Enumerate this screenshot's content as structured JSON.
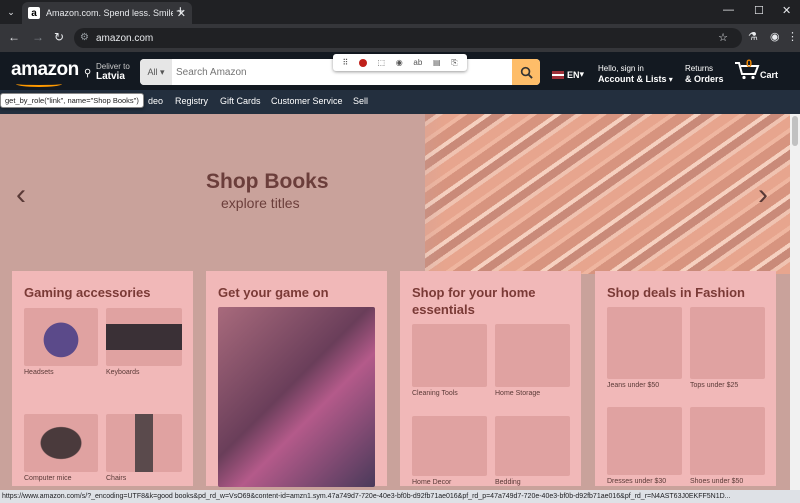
{
  "browser": {
    "tab_title": "Amazon.com. Spend less. Smile",
    "url": "amazon.com",
    "status_url": "https://www.amazon.com/s/?_encoding=UTF8&k=good books&pd_rd_w=VsO69&content-id=amzn1.sym.47a749d7-720e-40e3-bf0b-d92fb71ae016&pf_rd_p=47a749d7-720e-40e3-bf0b-d92fb71ae016&pf_rd_r=N4AST63J0EKFF5N1D..."
  },
  "header": {
    "logo": "amazon",
    "deliver_line1": "Deliver to",
    "deliver_line2": "Latvia",
    "search_category": "All",
    "search_placeholder": "Search Amazon",
    "language": "EN",
    "account_line1": "Hello, sign in",
    "account_line2": "Account & Lists",
    "orders_line1": "Returns",
    "orders_line2": "& Orders",
    "cart_count": "0",
    "cart_label": "Cart"
  },
  "nav": {
    "items": [
      "deo",
      "Registry",
      "Gift Cards",
      "Customer Service",
      "Sell"
    ]
  },
  "tooltip": "get_by_role(\"link\", name=\"Shop Books\")",
  "hero": {
    "title": "Shop Books",
    "subtitle": "explore titles"
  },
  "cards": [
    {
      "title": "Gaming accessories",
      "tiles": [
        "Headsets",
        "Keyboards",
        "Computer mice",
        "Chairs"
      ]
    },
    {
      "title": "Get your game on"
    },
    {
      "title": "Shop for your home essentials",
      "tiles": [
        "Cleaning Tools",
        "Home Storage",
        "Home Decor",
        "Bedding"
      ]
    },
    {
      "title": "Shop deals in Fashion",
      "tiles": [
        "Jeans under $50",
        "Tops under $25",
        "Dresses under $30",
        "Shoes under $50"
      ]
    }
  ]
}
